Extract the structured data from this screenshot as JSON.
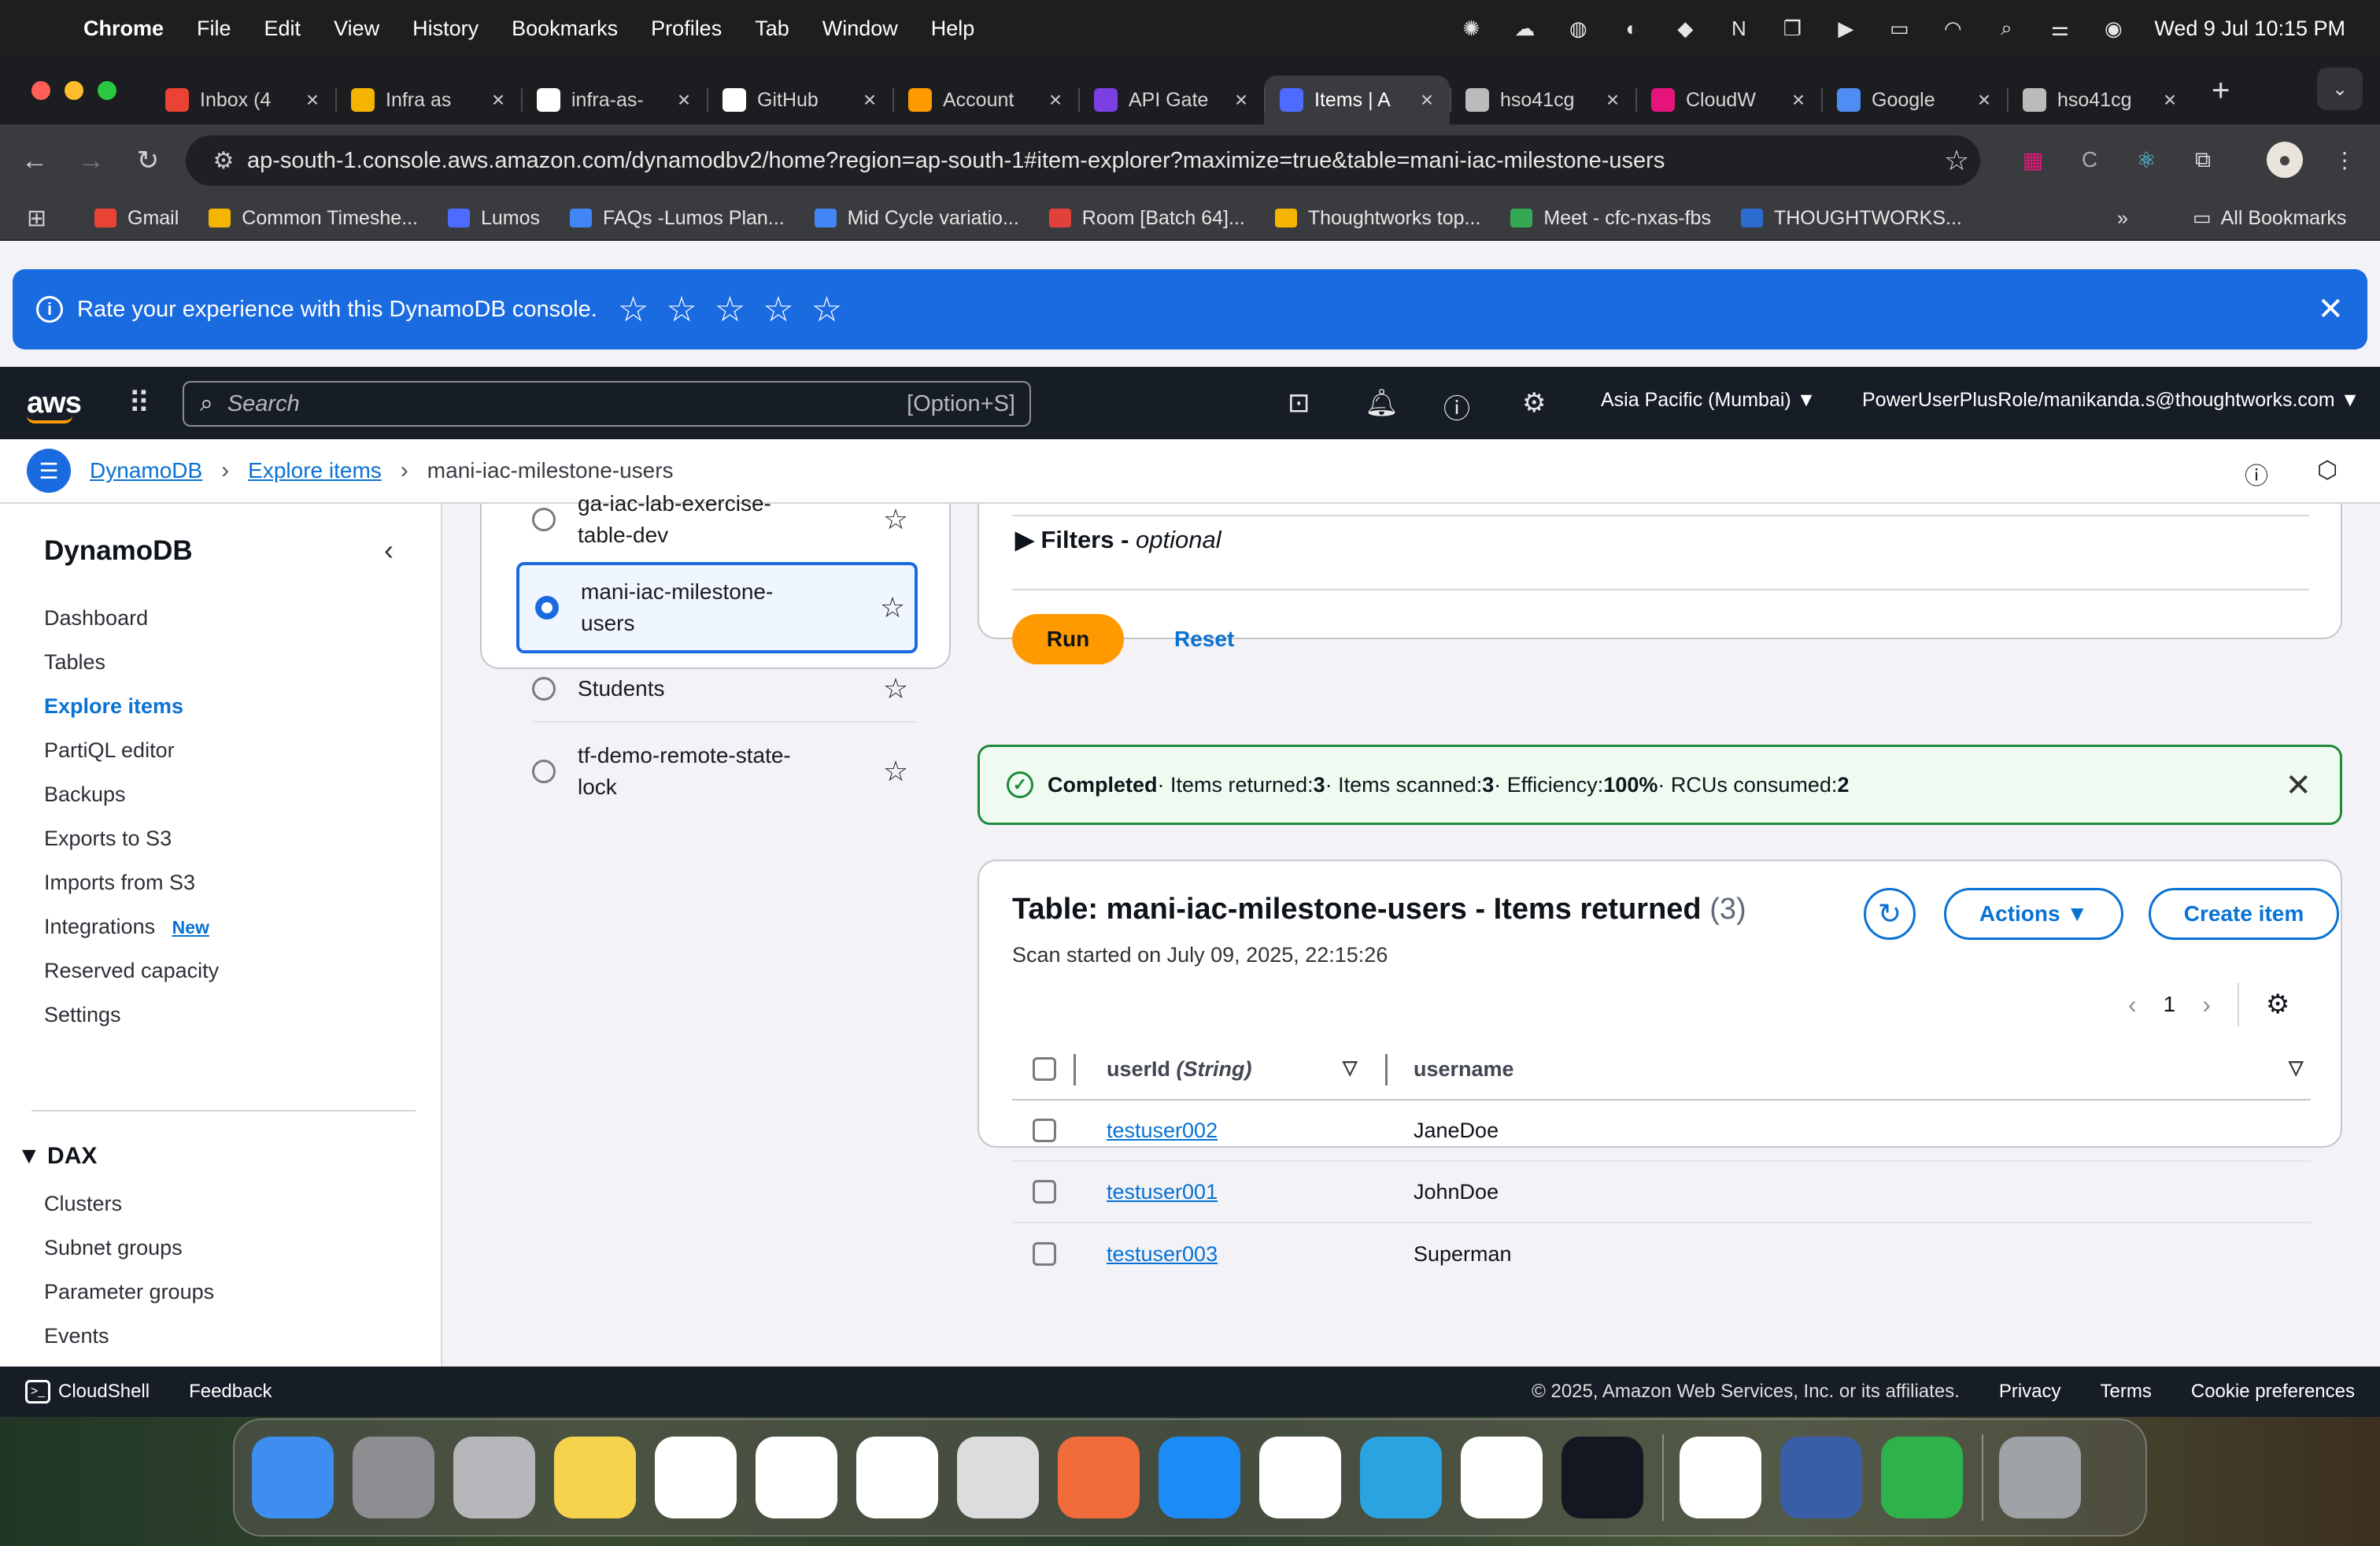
{
  "menubar": {
    "app": "Chrome",
    "items": [
      "File",
      "Edit",
      "View",
      "History",
      "Bookmarks",
      "Profiles",
      "Tab",
      "Window",
      "Help"
    ],
    "clock": "Wed 9 Jul  10:15 PM"
  },
  "tabs": [
    {
      "label": "Inbox (4",
      "icon": "gmail-icon",
      "color": "#ea4335"
    },
    {
      "label": "Infra as",
      "icon": "slides-icon",
      "color": "#f4b400"
    },
    {
      "label": "infra-as-",
      "icon": "github-icon",
      "color": "#ffffff"
    },
    {
      "label": "GitHub",
      "icon": "github-icon",
      "color": "#ffffff"
    },
    {
      "label": "Account",
      "icon": "aws-box-icon",
      "color": "#ff9900"
    },
    {
      "label": "API Gate",
      "icon": "api-gateway-icon",
      "color": "#7b3fe4"
    },
    {
      "label": "Items | A",
      "icon": "dynamodb-icon",
      "color": "#4d6bfe",
      "active": true
    },
    {
      "label": "hso41cg",
      "icon": "globe-icon",
      "color": "#bbbbbb"
    },
    {
      "label": "CloudW",
      "icon": "cloudwatch-icon",
      "color": "#e7157b"
    },
    {
      "label": "Google",
      "icon": "gemini-icon",
      "color": "#4f8df5"
    },
    {
      "label": "hso41cg",
      "icon": "globe-icon",
      "color": "#bbbbbb"
    }
  ],
  "omnibox": {
    "url": "ap-south-1.console.aws.amazon.com/dynamodbv2/home?region=ap-south-1#item-explorer?maximize=true&table=mani-iac-milestone-users"
  },
  "bookmarks": [
    {
      "label": "Gmail",
      "color": "#ea4335"
    },
    {
      "label": "Common Timeshe...",
      "color": "#f4b400"
    },
    {
      "label": "Lumos",
      "color": "#4d6bfe"
    },
    {
      "label": "FAQs -Lumos Plan...",
      "color": "#4285f4"
    },
    {
      "label": "Mid Cycle variatio...",
      "color": "#4285f4"
    },
    {
      "label": "Room [Batch 64]...",
      "color": "#e0413a"
    },
    {
      "label": "Thoughtworks top...",
      "color": "#f4b400"
    },
    {
      "label": "Meet - cfc-nxas-fbs",
      "color": "#34a853"
    },
    {
      "label": "THOUGHTWORKS...",
      "color": "#2c6bd0"
    }
  ],
  "bookmarks_more": "»",
  "all_bookmarks": "All Bookmarks",
  "rating": {
    "text": "Rate your experience with this DynamoDB console.",
    "stars": [
      "☆",
      "☆",
      "☆",
      "☆",
      "☆"
    ]
  },
  "awsnav": {
    "logo": "aws",
    "search_placeholder": "Search",
    "shortcut": "[Option+S]",
    "region": "Asia Pacific (Mumbai) ▼",
    "role": "PowerUserPlusRole/manikanda.s@thoughtworks.com ▼"
  },
  "breadcrumb": {
    "root": "DynamoDB",
    "section": "Explore items",
    "current": "mani-iac-milestone-users"
  },
  "sidebar": {
    "title": "DynamoDB",
    "items": [
      "Dashboard",
      "Tables",
      "Explore items",
      "PartiQL editor",
      "Backups",
      "Exports to S3",
      "Imports from S3",
      "Integrations",
      "Reserved capacity",
      "Settings"
    ],
    "new_badge": "New",
    "dax_title": "DAX",
    "dax_items": [
      "Clusters",
      "Subnet groups",
      "Parameter groups",
      "Events"
    ]
  },
  "tables": [
    {
      "name": "ga-iac-lab-exercise-table-dev",
      "line1": "ga-iac-lab-exercise-",
      "line2": "table-dev"
    },
    {
      "name": "mani-iac-milestone-users",
      "line1": "mani-iac-milestone-",
      "line2": "users",
      "selected": true
    },
    {
      "name": "Students",
      "line1": "Students",
      "line2": ""
    },
    {
      "name": "tf-demo-remote-state-lock",
      "line1": "tf-demo-remote-state-",
      "line2": "lock"
    }
  ],
  "scan": {
    "filters_label": "Filters - ",
    "filters_optional": "optional",
    "run_label": "Run",
    "reset_label": "Reset"
  },
  "status": {
    "title": "Completed",
    "items_returned_label": " · Items returned: ",
    "items_returned": "3",
    "items_scanned_label": " · Items scanned: ",
    "items_scanned": "3",
    "efficiency_label": " · Efficiency: ",
    "efficiency": "100%",
    "rcu_label": " · RCUs consumed: ",
    "rcu": "2"
  },
  "results": {
    "title": "Table: mani-iac-milestone-users - Items returned",
    "count": "(3)",
    "scan_started": "Scan started on July 09, 2025, 22:15:26",
    "actions_label": "Actions ▼",
    "create_label": "Create item",
    "page": "1",
    "columns": {
      "userId": "userId",
      "userId_type": "(String)",
      "username": "username"
    },
    "rows": [
      {
        "userId": "testuser002",
        "username": "JaneDoe"
      },
      {
        "userId": "testuser001",
        "username": "JohnDoe"
      },
      {
        "userId": "testuser003",
        "username": "Superman"
      }
    ]
  },
  "footer": {
    "cloudshell": "CloudShell",
    "feedback": "Feedback",
    "copyright": "© 2025, Amazon Web Services, Inc. or its affiliates.",
    "privacy": "Privacy",
    "terms": "Terms",
    "cookies": "Cookie preferences"
  },
  "dock": [
    {
      "name": "finder-icon",
      "color": "#3d8ef0"
    },
    {
      "name": "system-settings-icon",
      "color": "#8d8d92"
    },
    {
      "name": "launchpad-icon",
      "color": "#b6b6bb"
    },
    {
      "name": "notes-icon",
      "color": "#f6d34c"
    },
    {
      "name": "notion-icon",
      "color": "#ffffff"
    },
    {
      "name": "chatgpt-icon",
      "color": "#ffffff"
    },
    {
      "name": "chrome-icon",
      "color": "#ffffff"
    },
    {
      "name": "screenshot-icon",
      "color": "#dcdcdc"
    },
    {
      "name": "postman-icon",
      "color": "#f26b3a"
    },
    {
      "name": "app-store-icon",
      "color": "#1b8cf5"
    },
    {
      "name": "vscode-icon",
      "color": "#ffffff"
    },
    {
      "name": "telegram-icon",
      "color": "#2aa3e0"
    },
    {
      "name": "mongodb-icon",
      "color": "#ffffff"
    },
    {
      "name": "tradingview-icon",
      "color": "#131722"
    },
    {
      "name": "chrome-icon",
      "color": "#ffffff"
    },
    {
      "name": "preview-icon",
      "color": "#3a5da8"
    },
    {
      "name": "numbers-icon",
      "color": "#2db24c"
    },
    {
      "name": "trash-icon",
      "color": "#9ea3a8"
    }
  ]
}
